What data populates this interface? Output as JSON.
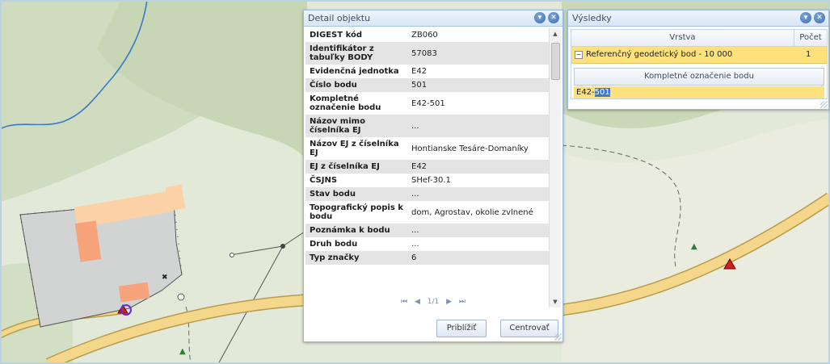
{
  "detail": {
    "title": "Detail objektu",
    "collapse_icon": "chevron-down-circle-icon",
    "close_icon": "close-circle-icon",
    "rows": [
      {
        "key": "DIGEST kód",
        "value": "ZB060"
      },
      {
        "key": "Identifikátor z tabuľky BODY",
        "value": "57083"
      },
      {
        "key": "Evidenčná jednotka",
        "value": "E42"
      },
      {
        "key": "Číslo bodu",
        "value": "501"
      },
      {
        "key": "Kompletné označenie bodu",
        "value": "E42-501"
      },
      {
        "key": "Názov mimo číselníka EJ",
        "value": "..."
      },
      {
        "key": "Názov EJ z číselníka EJ",
        "value": "Hontianske Tesáre-Domaníky"
      },
      {
        "key": "EJ z číselníka EJ",
        "value": "E42"
      },
      {
        "key": "ČSJNS",
        "value": "SHef-30.1"
      },
      {
        "key": "Stav bodu",
        "value": "..."
      },
      {
        "key": "Topografický popis k bodu",
        "value": "dom, Agrostav, okolie zvlnené"
      },
      {
        "key": "Poznámka k bodu",
        "value": "..."
      },
      {
        "key": "Druh bodu",
        "value": "..."
      },
      {
        "key": "Typ značky",
        "value": "6"
      }
    ],
    "pager": {
      "first": "⏮",
      "prev": "◀",
      "page": "1/1",
      "next": "▶",
      "last": "⏭"
    },
    "zoom_button": "Priblížiť",
    "center_button": "Centrovať"
  },
  "results": {
    "title": "Výsledky",
    "col_layer": "Vrstva",
    "col_count": "Počet",
    "group_label": "Referenčný geodetický bod - 10 000",
    "group_count": "1",
    "sub_header": "Kompletné označenie bodu",
    "sub_value_prefix": "E42-",
    "sub_value_highlight": "501"
  },
  "colors": {
    "map_bg": "#e2e9d6",
    "forest": "#c9d9b8",
    "road": "#f4d78a",
    "river": "#3c78c8",
    "building": "#f7a37c",
    "highlight": "#fce17c"
  }
}
